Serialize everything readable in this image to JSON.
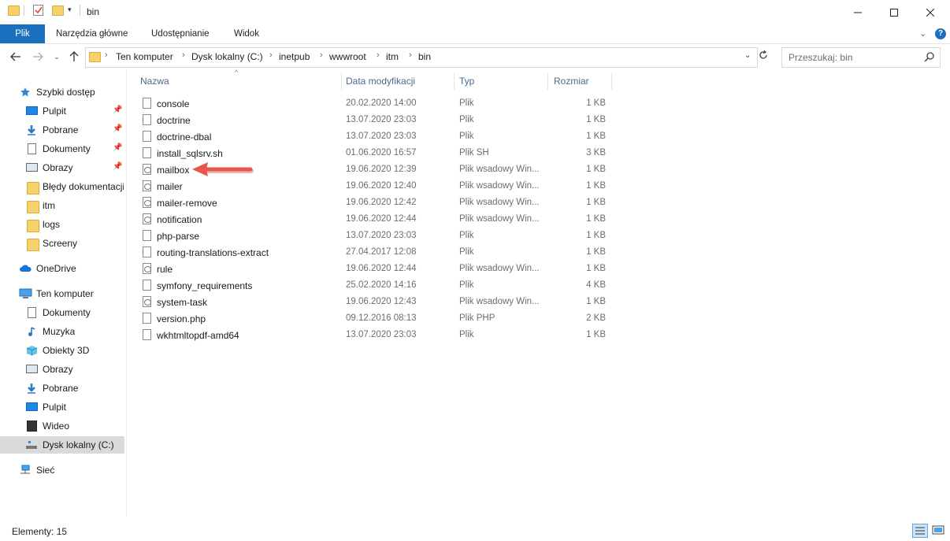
{
  "window": {
    "title": "bin"
  },
  "ribbon": {
    "tabs": [
      "Plik",
      "Narzędzia główne",
      "Udostępnianie",
      "Widok"
    ]
  },
  "address": {
    "crumbs": [
      "Ten komputer",
      "Dysk lokalny (C:)",
      "inetpub",
      "wwwroot",
      "itm",
      "bin"
    ]
  },
  "search": {
    "placeholder": "Przeszukaj: bin"
  },
  "sidebar": {
    "quick_access": "Szybki dostęp",
    "quick_items": [
      "Pulpit",
      "Pobrane",
      "Dokumenty",
      "Obrazy",
      "Błędy dokumentacji",
      "itm",
      "logs",
      "Screeny"
    ],
    "onedrive": "OneDrive",
    "this_pc": "Ten komputer",
    "pc_items": [
      "Dokumenty",
      "Muzyka",
      "Obiekty 3D",
      "Obrazy",
      "Pobrane",
      "Pulpit",
      "Wideo",
      "Dysk lokalny (C:)"
    ],
    "network": "Sieć"
  },
  "columns": {
    "name": "Nazwa",
    "date": "Data modyfikacji",
    "type": "Typ",
    "size": "Rozmiar"
  },
  "files": [
    {
      "name": "console",
      "date": "20.02.2020 14:00",
      "type": "Plik",
      "size": "1 KB",
      "icon": "file-icon"
    },
    {
      "name": "doctrine",
      "date": "13.07.2020 23:03",
      "type": "Plik",
      "size": "1 KB",
      "icon": "file-icon"
    },
    {
      "name": "doctrine-dbal",
      "date": "13.07.2020 23:03",
      "type": "Plik",
      "size": "1 KB",
      "icon": "file-icon"
    },
    {
      "name": "install_sqlsrv.sh",
      "date": "01.06.2020 16:57",
      "type": "Plik SH",
      "size": "3 KB",
      "icon": "file-icon"
    },
    {
      "name": "mailbox",
      "date": "19.06.2020 12:39",
      "type": "Plik wsadowy Win...",
      "size": "1 KB",
      "icon": "batch-file-icon"
    },
    {
      "name": "mailer",
      "date": "19.06.2020 12:40",
      "type": "Plik wsadowy Win...",
      "size": "1 KB",
      "icon": "batch-file-icon"
    },
    {
      "name": "mailer-remove",
      "date": "19.06.2020 12:42",
      "type": "Plik wsadowy Win...",
      "size": "1 KB",
      "icon": "batch-file-icon"
    },
    {
      "name": "notification",
      "date": "19.06.2020 12:44",
      "type": "Plik wsadowy Win...",
      "size": "1 KB",
      "icon": "batch-file-icon"
    },
    {
      "name": "php-parse",
      "date": "13.07.2020 23:03",
      "type": "Plik",
      "size": "1 KB",
      "icon": "file-icon"
    },
    {
      "name": "routing-translations-extract",
      "date": "27.04.2017 12:08",
      "type": "Plik",
      "size": "1 KB",
      "icon": "file-icon"
    },
    {
      "name": "rule",
      "date": "19.06.2020 12:44",
      "type": "Plik wsadowy Win...",
      "size": "1 KB",
      "icon": "batch-file-icon"
    },
    {
      "name": "symfony_requirements",
      "date": "25.02.2020 14:16",
      "type": "Plik",
      "size": "4 KB",
      "icon": "file-icon"
    },
    {
      "name": "system-task",
      "date": "19.06.2020 12:43",
      "type": "Plik wsadowy Win...",
      "size": "1 KB",
      "icon": "batch-file-icon"
    },
    {
      "name": "version.php",
      "date": "09.12.2016 08:13",
      "type": "Plik PHP",
      "size": "2 KB",
      "icon": "file-icon"
    },
    {
      "name": "wkhtmltopdf-amd64",
      "date": "13.07.2020 23:03",
      "type": "Plik",
      "size": "1 KB",
      "icon": "file-icon"
    }
  ],
  "status": {
    "items_count": "Elementy: 15"
  },
  "colors": {
    "accent": "#1a6fbf",
    "arrow": "#e8584a",
    "selection": "#d9d9d9"
  }
}
